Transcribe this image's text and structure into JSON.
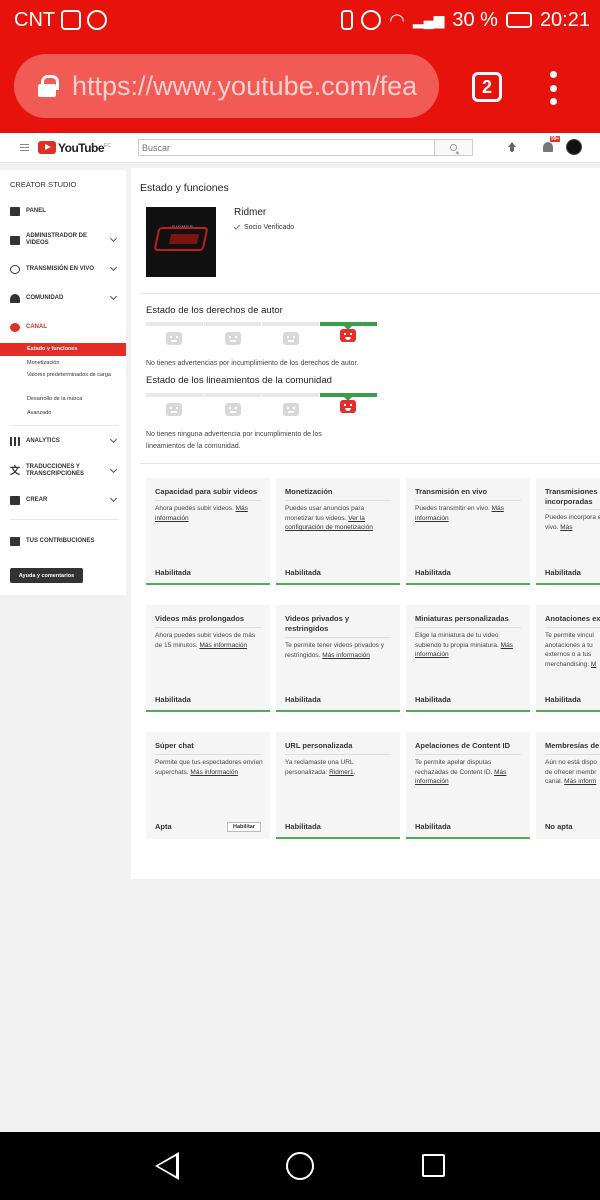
{
  "statusbar": {
    "carrier": "CNT",
    "battery": "30 %",
    "time": "20:21"
  },
  "browser": {
    "url": "https://www.youtube.com/fea",
    "tab_count": "2"
  },
  "header": {
    "logo_text": "YouTube",
    "logo_region": "EC",
    "search_placeholder": "Buscar",
    "notif_badge": "99+"
  },
  "sidebar": {
    "title": "CREATOR STUDIO",
    "items": [
      {
        "label": "PANEL"
      },
      {
        "label": "ADMINISTRADOR DE VIDEOS"
      },
      {
        "label": "TRANSMISIÓN EN VIVO"
      },
      {
        "label": "COMUNIDAD"
      },
      {
        "label": "CANAL"
      },
      {
        "label": "ANALYTICS"
      },
      {
        "label": "TRADUCCIONES Y TRANSCRIPCIONES"
      },
      {
        "label": "CREAR"
      },
      {
        "label": "TUS CONTRIBUCIONES"
      }
    ],
    "sub_items": [
      "Estado y funciones",
      "Monetización",
      "Valores predeterminados de carga",
      "Desarrollo de la marca",
      "Avanzado"
    ],
    "help_button": "Ayuda y comentarios"
  },
  "main": {
    "title": "Estado y funciones",
    "channel_name": "Ridmer",
    "verified_label": "Socio Verificado",
    "copyright": {
      "title": "Estado de los derechos de autor",
      "message": "No tienes advertencias por incumplimiento de los derechos de autor."
    },
    "community": {
      "title": "Estado de los lineamientos de la comunidad",
      "message": "No tienes ninguna advertencia por incumplimiento de los lineamientos de la comunidad."
    },
    "cards": [
      {
        "title": "Capacidad para subir videos",
        "desc": "Ahora puedes subir videos.",
        "link": "Más información",
        "status": "Habilitada"
      },
      {
        "title": "Monetización",
        "desc": "Puedes usar anuncios para monetizar tus videos.",
        "link": "Ver la configuración de monetización",
        "status": "Habilitada"
      },
      {
        "title": "Transmisión en vivo",
        "desc": "Puedes transmitir en vivo.",
        "link": "Más información",
        "status": "Habilitada"
      },
      {
        "title": "Transmisiones incorporadas",
        "desc": "Puedes incorpora en vivo.",
        "link": "Más",
        "status": "Habilitada"
      },
      {
        "title": "Videos más prolongados",
        "desc": "Ahora puedes subir videos de más de 15 minutos.",
        "link": "Más información",
        "status": "Habilitada"
      },
      {
        "title": "Videos privados y restringidos",
        "desc": "Te permite tener videos privados y restringidos.",
        "link": "Más información",
        "status": "Habilitada"
      },
      {
        "title": "Miniaturas personalizadas",
        "desc": "Elige la miniatura de tu video subiendo tu propia miniatura.",
        "link": "Más información",
        "status": "Habilitada"
      },
      {
        "title": "Anotaciones ex",
        "desc": "Te permite vincul anotaciones a tu externos o a tus merchandising.",
        "link": "M",
        "status": "Habilitada"
      },
      {
        "title": "Súper chat",
        "desc": "Permite que tus espectadores envíen superchats.",
        "link": "Más información",
        "status": "Apta",
        "button": "Habilitar"
      },
      {
        "title": "URL personalizada",
        "desc": "Ya reclamaste una URL personalizada:",
        "link": "Ridmer1",
        "status": "Habilitada"
      },
      {
        "title": "Apelaciones de Content ID",
        "desc": "Te permite apelar disputas rechazadas de Content ID.",
        "link": "Más información",
        "status": "Habilitada"
      },
      {
        "title": "Membresías de",
        "desc": "Aún no está dispo de ofrecer membr canal.",
        "link": "Más inform",
        "status": "No apta"
      }
    ]
  }
}
